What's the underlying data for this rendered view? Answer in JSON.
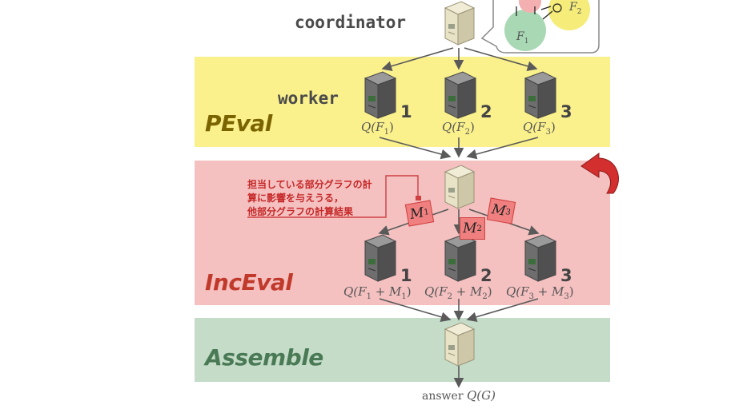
{
  "labels": {
    "coordinator": "coordinator",
    "worker": "worker"
  },
  "phases": [
    {
      "name": "PEval",
      "color": "#7a6400"
    },
    {
      "name": "IncEval",
      "color": "#c0392b"
    },
    {
      "name": "Assemble",
      "color": "#4a7a55"
    }
  ],
  "worker_ids": [
    "1",
    "2",
    "3"
  ],
  "peval_outputs": [
    {
      "prefix": "Q(F",
      "sub": "1",
      "suffix": ")"
    },
    {
      "prefix": "Q(F",
      "sub": "2",
      "suffix": ")"
    },
    {
      "prefix": "Q(F",
      "sub": "3",
      "suffix": ")"
    }
  ],
  "inceval_outputs": [
    {
      "prefix": "Q(F",
      "sub": "1",
      "mid": " + M",
      "sub2": "1",
      "suffix": ")"
    },
    {
      "prefix": "Q(F",
      "sub": "2",
      "mid": " + M",
      "sub2": "2",
      "suffix": ")"
    },
    {
      "prefix": "Q(F",
      "sub": "3",
      "mid": " + M",
      "sub2": "3",
      "suffix": ")"
    }
  ],
  "messages": [
    {
      "base": "M",
      "sub": "1"
    },
    {
      "base": "M",
      "sub": "2"
    },
    {
      "base": "M",
      "sub": "3"
    }
  ],
  "note": "担当している部分グラフの計\n算に影響を与えうる，\n他部分グラフの計算結果",
  "fragments": [
    {
      "base": "F",
      "sub": "1"
    },
    {
      "base": "F",
      "sub": "2"
    }
  ],
  "answer": {
    "word": "answer",
    "expr": "Q(G)"
  },
  "colors": {
    "peval_band": "#faf08c",
    "inceval_band": "#f4c0c0",
    "assemble_band": "#c4dcc8",
    "message_fill": "#f08080",
    "note_text": "#c62828",
    "cycle_arrow": "#d32f2f"
  },
  "icons": [
    "server-icon",
    "cycle-arrow-icon",
    "graph-bubble-icon"
  ]
}
